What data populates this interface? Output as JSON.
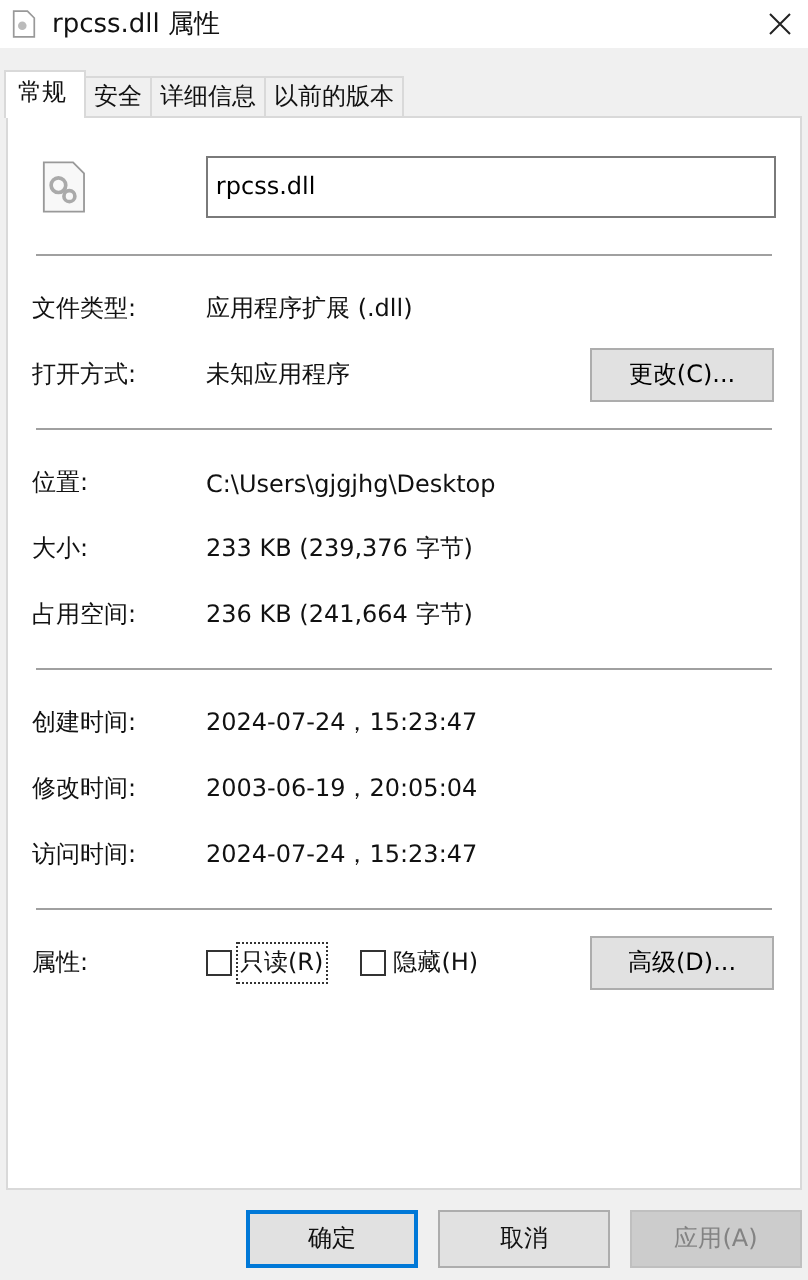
{
  "window": {
    "title": "rpcss.dll 属性"
  },
  "tabs": [
    {
      "label": "常规",
      "selected": true
    },
    {
      "label": "安全",
      "selected": false
    },
    {
      "label": "详细信息",
      "selected": false
    },
    {
      "label": "以前的版本",
      "selected": false
    }
  ],
  "file_name": {
    "value": "rpcss.dll"
  },
  "sections": [
    {
      "rows": [
        {
          "label": "文件类型:",
          "value": "应用程序扩展 (.dll)"
        },
        {
          "label": "打开方式:",
          "value": "未知应用程序",
          "button": "更改(C)..."
        }
      ]
    },
    {
      "rows": [
        {
          "label": "位置:",
          "value": "C:\\Users\\gjgjhg\\Desktop"
        },
        {
          "label": "大小:",
          "value": "233 KB (239,376 字节)"
        },
        {
          "label": "占用空间:",
          "value": "236 KB (241,664 字节)"
        }
      ]
    },
    {
      "rows": [
        {
          "label": "创建时间:",
          "value": "2024-07-24，15:23:47"
        },
        {
          "label": "修改时间:",
          "value": "2003-06-19，20:05:04"
        },
        {
          "label": "访问时间:",
          "value": "2024-07-24，15:23:47"
        }
      ]
    }
  ],
  "attributes": {
    "label": "属性:",
    "checkboxes": [
      {
        "label": "只读(R)",
        "checked": false,
        "focused": true
      },
      {
        "label": "隐藏(H)",
        "checked": false,
        "focused": false
      }
    ],
    "button": "高级(D)..."
  },
  "buttons": [
    {
      "label": "确定",
      "default": true,
      "disabled": false
    },
    {
      "label": "取消",
      "default": false,
      "disabled": false
    },
    {
      "label": "应用(A)",
      "default": false,
      "disabled": true
    }
  ]
}
